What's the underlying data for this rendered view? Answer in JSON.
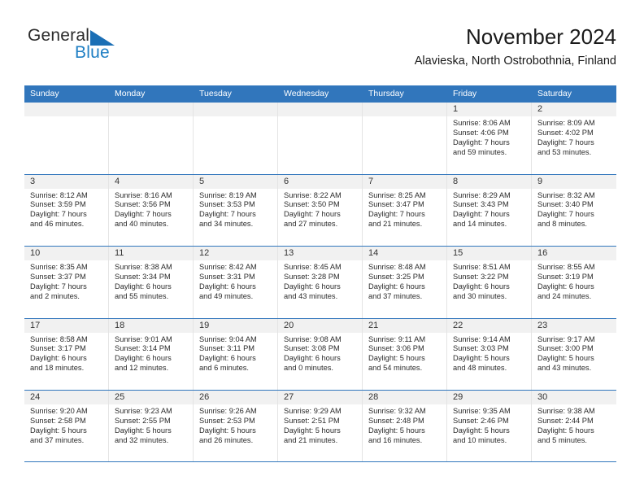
{
  "brand": {
    "name_part1": "General",
    "name_part2": "Blue",
    "logo_icon": "triangle-logo"
  },
  "header": {
    "month_title": "November 2024",
    "location": "Alavieska, North Ostrobothnia, Finland"
  },
  "colors": {
    "header_blue": "#3176bc",
    "brand_blue": "#1f7fc4",
    "day_band_gray": "#f1f1f1",
    "cell_border": "#e4e4e4"
  },
  "calendar": {
    "weekday_headers": [
      "Sunday",
      "Monday",
      "Tuesday",
      "Wednesday",
      "Thursday",
      "Friday",
      "Saturday"
    ],
    "weeks": [
      [
        {
          "day": "",
          "lines": []
        },
        {
          "day": "",
          "lines": []
        },
        {
          "day": "",
          "lines": []
        },
        {
          "day": "",
          "lines": []
        },
        {
          "day": "",
          "lines": []
        },
        {
          "day": "1",
          "lines": [
            "Sunrise: 8:06 AM",
            "Sunset: 4:06 PM",
            "Daylight: 7 hours",
            "and 59 minutes."
          ]
        },
        {
          "day": "2",
          "lines": [
            "Sunrise: 8:09 AM",
            "Sunset: 4:02 PM",
            "Daylight: 7 hours",
            "and 53 minutes."
          ]
        }
      ],
      [
        {
          "day": "3",
          "lines": [
            "Sunrise: 8:12 AM",
            "Sunset: 3:59 PM",
            "Daylight: 7 hours",
            "and 46 minutes."
          ]
        },
        {
          "day": "4",
          "lines": [
            "Sunrise: 8:16 AM",
            "Sunset: 3:56 PM",
            "Daylight: 7 hours",
            "and 40 minutes."
          ]
        },
        {
          "day": "5",
          "lines": [
            "Sunrise: 8:19 AM",
            "Sunset: 3:53 PM",
            "Daylight: 7 hours",
            "and 34 minutes."
          ]
        },
        {
          "day": "6",
          "lines": [
            "Sunrise: 8:22 AM",
            "Sunset: 3:50 PM",
            "Daylight: 7 hours",
            "and 27 minutes."
          ]
        },
        {
          "day": "7",
          "lines": [
            "Sunrise: 8:25 AM",
            "Sunset: 3:47 PM",
            "Daylight: 7 hours",
            "and 21 minutes."
          ]
        },
        {
          "day": "8",
          "lines": [
            "Sunrise: 8:29 AM",
            "Sunset: 3:43 PM",
            "Daylight: 7 hours",
            "and 14 minutes."
          ]
        },
        {
          "day": "9",
          "lines": [
            "Sunrise: 8:32 AM",
            "Sunset: 3:40 PM",
            "Daylight: 7 hours",
            "and 8 minutes."
          ]
        }
      ],
      [
        {
          "day": "10",
          "lines": [
            "Sunrise: 8:35 AM",
            "Sunset: 3:37 PM",
            "Daylight: 7 hours",
            "and 2 minutes."
          ]
        },
        {
          "day": "11",
          "lines": [
            "Sunrise: 8:38 AM",
            "Sunset: 3:34 PM",
            "Daylight: 6 hours",
            "and 55 minutes."
          ]
        },
        {
          "day": "12",
          "lines": [
            "Sunrise: 8:42 AM",
            "Sunset: 3:31 PM",
            "Daylight: 6 hours",
            "and 49 minutes."
          ]
        },
        {
          "day": "13",
          "lines": [
            "Sunrise: 8:45 AM",
            "Sunset: 3:28 PM",
            "Daylight: 6 hours",
            "and 43 minutes."
          ]
        },
        {
          "day": "14",
          "lines": [
            "Sunrise: 8:48 AM",
            "Sunset: 3:25 PM",
            "Daylight: 6 hours",
            "and 37 minutes."
          ]
        },
        {
          "day": "15",
          "lines": [
            "Sunrise: 8:51 AM",
            "Sunset: 3:22 PM",
            "Daylight: 6 hours",
            "and 30 minutes."
          ]
        },
        {
          "day": "16",
          "lines": [
            "Sunrise: 8:55 AM",
            "Sunset: 3:19 PM",
            "Daylight: 6 hours",
            "and 24 minutes."
          ]
        }
      ],
      [
        {
          "day": "17",
          "lines": [
            "Sunrise: 8:58 AM",
            "Sunset: 3:17 PM",
            "Daylight: 6 hours",
            "and 18 minutes."
          ]
        },
        {
          "day": "18",
          "lines": [
            "Sunrise: 9:01 AM",
            "Sunset: 3:14 PM",
            "Daylight: 6 hours",
            "and 12 minutes."
          ]
        },
        {
          "day": "19",
          "lines": [
            "Sunrise: 9:04 AM",
            "Sunset: 3:11 PM",
            "Daylight: 6 hours",
            "and 6 minutes."
          ]
        },
        {
          "day": "20",
          "lines": [
            "Sunrise: 9:08 AM",
            "Sunset: 3:08 PM",
            "Daylight: 6 hours",
            "and 0 minutes."
          ]
        },
        {
          "day": "21",
          "lines": [
            "Sunrise: 9:11 AM",
            "Sunset: 3:06 PM",
            "Daylight: 5 hours",
            "and 54 minutes."
          ]
        },
        {
          "day": "22",
          "lines": [
            "Sunrise: 9:14 AM",
            "Sunset: 3:03 PM",
            "Daylight: 5 hours",
            "and 48 minutes."
          ]
        },
        {
          "day": "23",
          "lines": [
            "Sunrise: 9:17 AM",
            "Sunset: 3:00 PM",
            "Daylight: 5 hours",
            "and 43 minutes."
          ]
        }
      ],
      [
        {
          "day": "24",
          "lines": [
            "Sunrise: 9:20 AM",
            "Sunset: 2:58 PM",
            "Daylight: 5 hours",
            "and 37 minutes."
          ]
        },
        {
          "day": "25",
          "lines": [
            "Sunrise: 9:23 AM",
            "Sunset: 2:55 PM",
            "Daylight: 5 hours",
            "and 32 minutes."
          ]
        },
        {
          "day": "26",
          "lines": [
            "Sunrise: 9:26 AM",
            "Sunset: 2:53 PM",
            "Daylight: 5 hours",
            "and 26 minutes."
          ]
        },
        {
          "day": "27",
          "lines": [
            "Sunrise: 9:29 AM",
            "Sunset: 2:51 PM",
            "Daylight: 5 hours",
            "and 21 minutes."
          ]
        },
        {
          "day": "28",
          "lines": [
            "Sunrise: 9:32 AM",
            "Sunset: 2:48 PM",
            "Daylight: 5 hours",
            "and 16 minutes."
          ]
        },
        {
          "day": "29",
          "lines": [
            "Sunrise: 9:35 AM",
            "Sunset: 2:46 PM",
            "Daylight: 5 hours",
            "and 10 minutes."
          ]
        },
        {
          "day": "30",
          "lines": [
            "Sunrise: 9:38 AM",
            "Sunset: 2:44 PM",
            "Daylight: 5 hours",
            "and 5 minutes."
          ]
        }
      ]
    ]
  }
}
